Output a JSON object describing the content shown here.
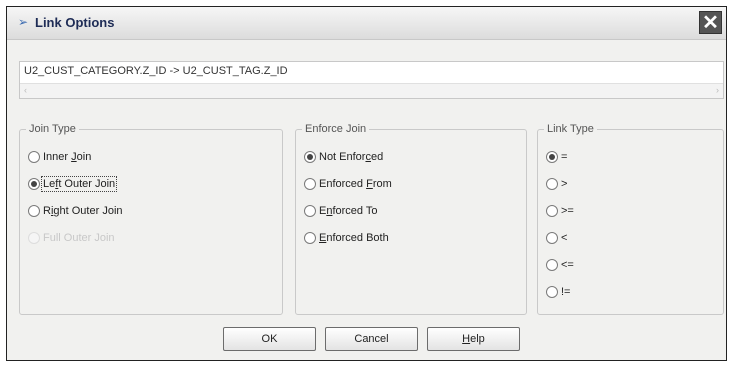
{
  "window": {
    "title": "Link Options",
    "close_icon": "close-x-icon",
    "title_icon": "chevron-arrow-icon"
  },
  "expression": "U2_CUST_CATEGORY.Z_ID -> U2_CUST_TAG.Z_ID",
  "scroll": {
    "left_arrow": "‹",
    "right_arrow": "›"
  },
  "join_type": {
    "legend": "Join Type",
    "options": [
      {
        "pre": "Inner ",
        "key": "J",
        "post": "oin",
        "selected": false,
        "disabled": false
      },
      {
        "pre": "Le",
        "key": "f",
        "post": "t Outer Join",
        "selected": true,
        "disabled": false
      },
      {
        "pre": "R",
        "key": "i",
        "post": "ght Outer Join",
        "selected": false,
        "disabled": false
      },
      {
        "pre": "Full Outer Join",
        "key": "",
        "post": "",
        "selected": false,
        "disabled": true
      }
    ]
  },
  "enforce_join": {
    "legend": "Enforce Join",
    "options": [
      {
        "pre": "Not Enfor",
        "key": "c",
        "post": "ed",
        "selected": true
      },
      {
        "pre": "Enforced ",
        "key": "F",
        "post": "rom",
        "selected": false
      },
      {
        "pre": "E",
        "key": "n",
        "post": "forced To",
        "selected": false
      },
      {
        "pre": "",
        "key": "E",
        "post": "nforced Both",
        "selected": false
      }
    ]
  },
  "link_type": {
    "legend": "Link Type",
    "options": [
      {
        "label": "=",
        "selected": true
      },
      {
        "label": ">",
        "selected": false
      },
      {
        "label": ">=",
        "selected": false
      },
      {
        "label": "<",
        "selected": false
      },
      {
        "label": "<=",
        "selected": false
      },
      {
        "label": "!=",
        "selected": false
      }
    ]
  },
  "buttons": {
    "ok": "OK",
    "cancel": "Cancel",
    "help_key": "H",
    "help_rest": "elp"
  }
}
